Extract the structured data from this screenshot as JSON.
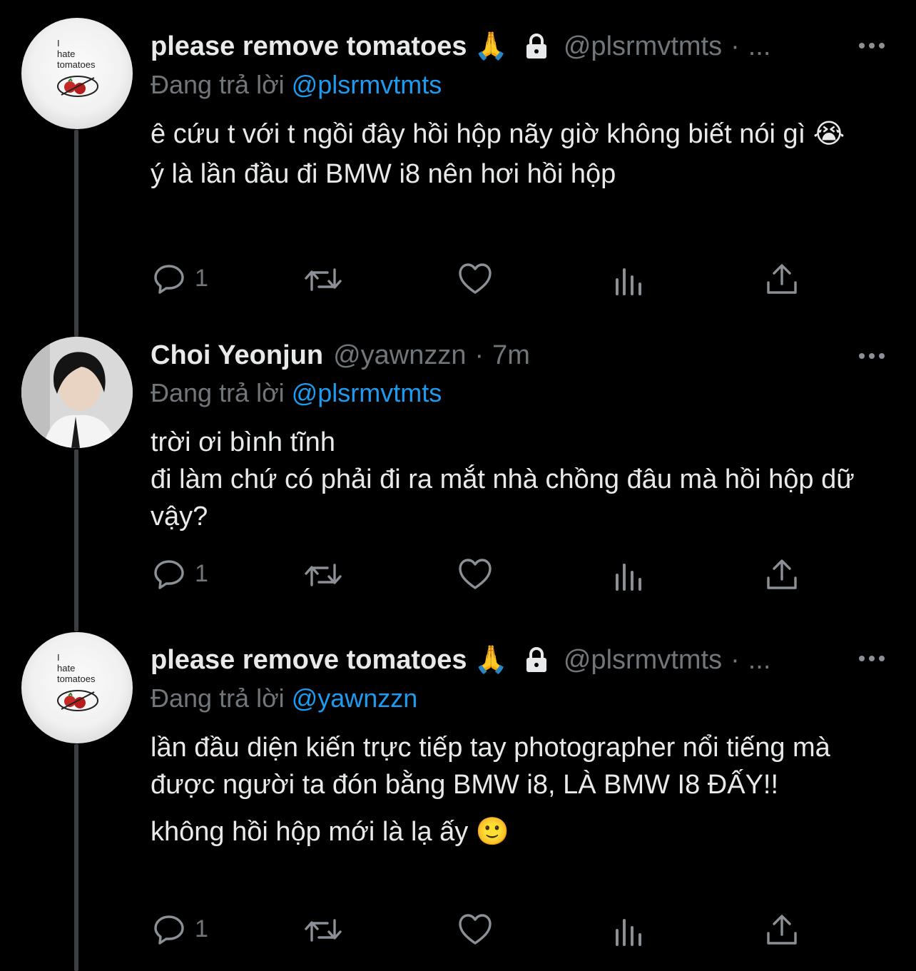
{
  "tweets": [
    {
      "display_name": "please remove tomatoes",
      "name_emoji": "🙏",
      "locked": true,
      "handle": "@plsrmvtmts",
      "separator": "·",
      "time": "...",
      "replying_prefix": "Đang trả lời",
      "replying_to": "@plsrmvtmts",
      "body": [
        "ê cứu t với t ngồi đây hồi hộp nãy giờ không biết nói gì 😭",
        "ý là lần đầu đi BMW i8 nên hơi hồi hộp"
      ],
      "reply_count": "1",
      "avatar": {
        "line1": "I",
        "line2": "hate",
        "line3": "tomatoes"
      }
    },
    {
      "display_name": "Choi Yeonjun",
      "handle": "@yawnzzn",
      "separator": "·",
      "time": "7m",
      "replying_prefix": "Đang trả lời",
      "replying_to": "@plsrmvtmts",
      "body": [
        "trời ơi bình tĩnh",
        "đi làm chứ có phải đi ra mắt nhà chồng đâu mà hồi hộp dữ vậy?"
      ],
      "reply_count": "1"
    },
    {
      "display_name": "please remove tomatoes",
      "name_emoji": "🙏",
      "locked": true,
      "handle": "@plsrmvtmts",
      "separator": "·",
      "time": "...",
      "replying_prefix": "Đang trả lời",
      "replying_to": "@yawnzzn",
      "body": [
        "lần đầu diện kiến trực tiếp tay photographer nổi tiếng mà được người ta đón bằng BMW i8, LÀ BMW I8 ĐẤY!!",
        "không hồi hộp mới là lạ ấy 🙂"
      ],
      "reply_count": "1",
      "avatar": {
        "line1": "I",
        "line2": "hate",
        "line3": "tomatoes"
      }
    }
  ],
  "colors": {
    "background": "#000000",
    "text": "#e7e9ea",
    "secondary": "#71767b",
    "mention": "#1d9bf0",
    "thread_line": "#3a3d41"
  },
  "icons": [
    "lock-icon",
    "more-icon",
    "reply-icon",
    "retweet-icon",
    "like-icon",
    "analytics-icon",
    "share-icon"
  ]
}
